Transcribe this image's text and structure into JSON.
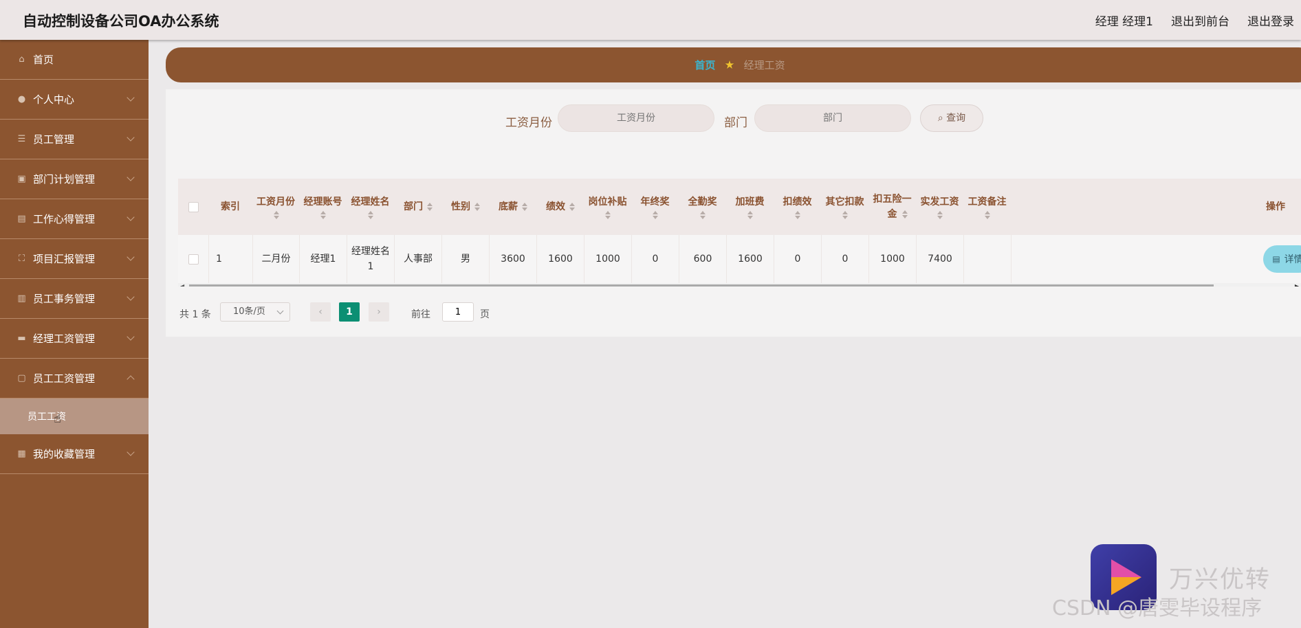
{
  "app": {
    "title": "自动控制设备公司OA办公系统"
  },
  "topbar": {
    "user": "经理 经理1",
    "front": "退出到前台",
    "logout": "退出登录"
  },
  "sidebar": {
    "items": [
      {
        "label": "首页",
        "icon": "home-icon"
      },
      {
        "label": "个人中心",
        "icon": "user-icon"
      },
      {
        "label": "员工管理",
        "icon": "list-icon"
      },
      {
        "label": "部门计划管理",
        "icon": "clipboard-icon"
      },
      {
        "label": "工作心得管理",
        "icon": "chart-icon"
      },
      {
        "label": "项目汇报管理",
        "icon": "frame-icon"
      },
      {
        "label": "员工事务管理",
        "icon": "bars-icon"
      },
      {
        "label": "经理工资管理",
        "icon": "monitor-icon"
      },
      {
        "label": "员工工资管理",
        "icon": "doc-icon"
      }
    ],
    "sub_item": "员工工资",
    "last_item": {
      "label": "我的收藏管理",
      "icon": "grid-icon"
    }
  },
  "breadcrumb": {
    "home": "首页",
    "current": "经理工资"
  },
  "search": {
    "label_month": "工资月份",
    "placeholder_month": "工资月份",
    "label_dept": "部门",
    "placeholder_dept": "部门",
    "button": "查询"
  },
  "table": {
    "headers": {
      "index": "索引",
      "month": "工资月份",
      "account": "经理账号",
      "name": "经理姓名",
      "dept": "部门",
      "gender": "性别",
      "base": "底薪",
      "perf": "绩效",
      "allowance": "岗位补贴",
      "bonus": "年终奖",
      "attendance": "全勤奖",
      "overtime": "加班费",
      "deduct_perf": "扣绩效",
      "other": "其它扣款",
      "insurance": "扣五险一金",
      "actual": "实发工资",
      "remark": "工资备注",
      "action": "操作"
    },
    "rows": [
      {
        "index": "1",
        "month": "二月份",
        "account": "经理1",
        "name": "经理姓名1",
        "dept": "人事部",
        "gender": "男",
        "base": "3600",
        "perf": "1600",
        "allowance": "1000",
        "bonus": "0",
        "attendance": "600",
        "overtime": "1600",
        "deduct_perf": "0",
        "other": "0",
        "insurance": "1000",
        "actual": "7400",
        "remark": "",
        "detail": "详情"
      }
    ]
  },
  "pagination": {
    "total": "共 1 条",
    "page_size": "10条/页",
    "current": "1",
    "goto": "前往",
    "goto_value": "1",
    "page_suffix": "页"
  },
  "watermark": {
    "brand": "万兴优转",
    "csdn": "CSDN @唐雯毕设程序"
  },
  "colors": {
    "sidebar": "#8c5530",
    "accent_teal": "#0c8f73",
    "detail_button": "#8dd7e6",
    "breadcrumb_home": "#3ab6d0"
  }
}
